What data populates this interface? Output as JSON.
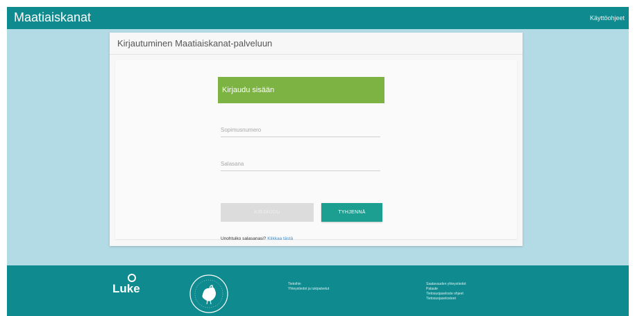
{
  "header": {
    "brand": "Maatiaiskanat",
    "help_link": "Käyttöohjeet"
  },
  "panel": {
    "title": "Kirjautuminen Maatiaiskanat-palveluun"
  },
  "login": {
    "header": "Kirjaudu sisään",
    "username_placeholder": "Sopimusnumero",
    "password_placeholder": "Salasana",
    "login_button": "KIRJAUDU",
    "clear_button": "TYHJENNÄ",
    "forgot_text": "Unohtuiko salasanasi?",
    "forgot_link": "Klikkaa tästä"
  },
  "footer": {
    "logo_text": "Luke",
    "col1": [
      "Tietoihin",
      "Yhteystiedot ja tukipalvelut"
    ],
    "col2": [
      "Saatavuuden yhteystiedot",
      "Palaute",
      "Tietosuojaseloste ohjeet",
      "Tietosuojaselosteet"
    ]
  },
  "colors": {
    "teal": "#0f8a8f",
    "background": "#b3dbe6",
    "login_header": "#7cb342",
    "clear_button": "#1c9e91"
  }
}
